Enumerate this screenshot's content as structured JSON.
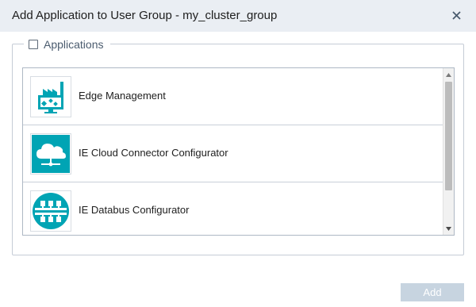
{
  "dialog": {
    "title": "Add Application to User Group - my_cluster_group",
    "close_glyph": "✕"
  },
  "applications": {
    "legend": "Applications",
    "select_all_checked": false,
    "items": [
      {
        "label": "Edge Management",
        "icon": "factory-monitor-icon"
      },
      {
        "label": "IE Cloud Connector Configurator",
        "icon": "cloud-network-icon"
      },
      {
        "label": "IE Databus Configurator",
        "icon": "databus-icon"
      }
    ]
  },
  "footer": {
    "add_label": "Add"
  },
  "colors": {
    "titlebar_bg": "#eaeef3",
    "accent_teal": "#00a4b4",
    "add_button_disabled": "#c7d4e0"
  }
}
